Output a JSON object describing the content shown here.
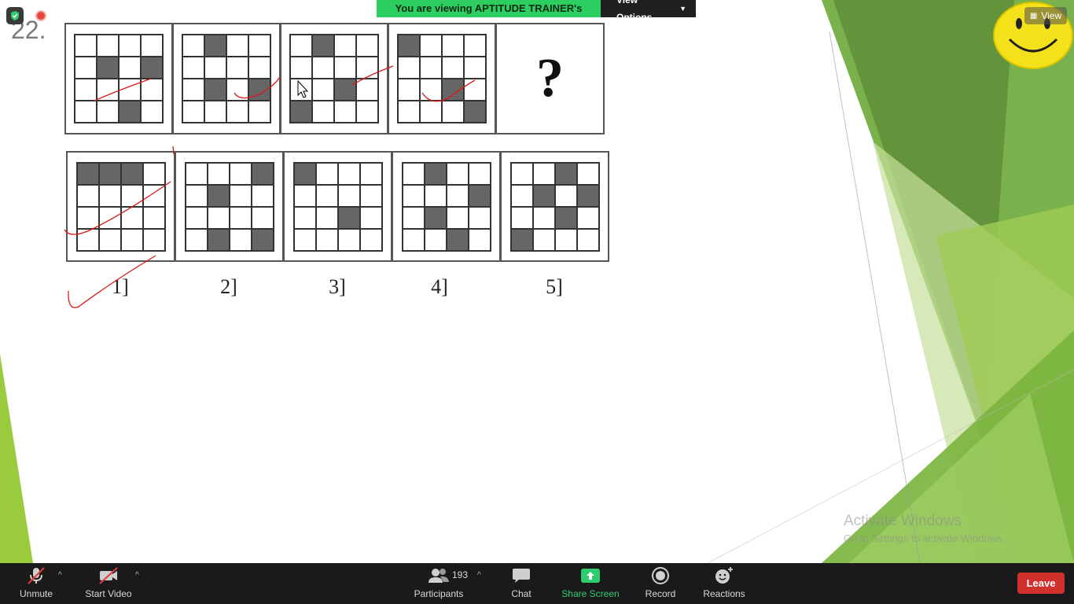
{
  "slide": {
    "number": "22."
  },
  "banner": {
    "message": "You are viewing APTITUDE TRAINER's screen",
    "view_options": "View Options"
  },
  "view_button": {
    "label": "View"
  },
  "question": {
    "problem_figures": [
      [
        [
          0,
          0,
          0,
          0
        ],
        [
          0,
          1,
          0,
          1
        ],
        [
          0,
          0,
          0,
          0
        ],
        [
          0,
          0,
          1,
          0
        ]
      ],
      [
        [
          0,
          1,
          0,
          0
        ],
        [
          0,
          0,
          0,
          0
        ],
        [
          0,
          1,
          0,
          1
        ],
        [
          0,
          0,
          0,
          0
        ]
      ],
      [
        [
          0,
          1,
          0,
          0
        ],
        [
          0,
          0,
          0,
          0
        ],
        [
          0,
          0,
          1,
          0
        ],
        [
          1,
          0,
          0,
          0
        ]
      ],
      [
        [
          1,
          0,
          0,
          0
        ],
        [
          0,
          0,
          0,
          0
        ],
        [
          0,
          0,
          1,
          0
        ],
        [
          0,
          0,
          0,
          1
        ]
      ]
    ],
    "unknown_mark": "?",
    "answer_figures": [
      {
        "label": "1]",
        "grid": [
          [
            1,
            1,
            1,
            0
          ],
          [
            0,
            0,
            0,
            0
          ],
          [
            0,
            0,
            0,
            0
          ],
          [
            0,
            0,
            0,
            0
          ]
        ]
      },
      {
        "label": "2]",
        "grid": [
          [
            0,
            0,
            0,
            1
          ],
          [
            0,
            1,
            0,
            0
          ],
          [
            0,
            0,
            0,
            0
          ],
          [
            0,
            1,
            0,
            1
          ]
        ]
      },
      {
        "label": "3]",
        "grid": [
          [
            1,
            0,
            0,
            0
          ],
          [
            0,
            0,
            0,
            0
          ],
          [
            0,
            0,
            1,
            0
          ],
          [
            0,
            0,
            0,
            0
          ]
        ]
      },
      {
        "label": "4]",
        "grid": [
          [
            0,
            1,
            0,
            0
          ],
          [
            0,
            0,
            0,
            1
          ],
          [
            0,
            1,
            0,
            0
          ],
          [
            0,
            0,
            1,
            0
          ]
        ]
      },
      {
        "label": "5]",
        "grid": [
          [
            0,
            0,
            1,
            0
          ],
          [
            0,
            1,
            0,
            1
          ],
          [
            0,
            0,
            1,
            0
          ],
          [
            1,
            0,
            0,
            0
          ]
        ]
      }
    ]
  },
  "watermark": {
    "line1": "Activate Windows",
    "line2": "Go to Settings to activate Windows."
  },
  "toolbar": {
    "unmute": "Unmute",
    "start_video": "Start Video",
    "participants": "Participants",
    "participants_count": "193",
    "chat": "Chat",
    "share_screen": "Share Screen",
    "record": "Record",
    "reactions": "Reactions",
    "leave": "Leave"
  },
  "colors": {
    "banner_green": "#2ccf5f",
    "leave_red": "#d0312d",
    "share_green": "#2ecc71",
    "ink_red": "#d81818",
    "slide_green": "#8cc63f"
  }
}
